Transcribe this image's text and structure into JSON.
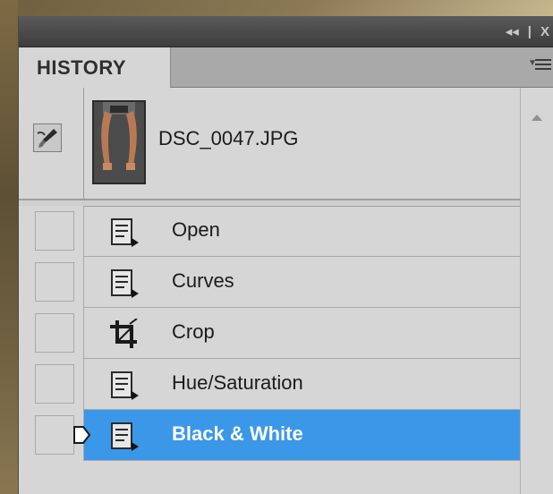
{
  "panel": {
    "title_controls": {
      "collapse": "◂◂",
      "separator": "|",
      "close": "X"
    },
    "tab": {
      "label": "HISTORY"
    },
    "menu": {
      "icon": "panel-menu-icon"
    }
  },
  "snapshot": {
    "name": "DSC_0047.JPG",
    "icon": "history-brush-icon"
  },
  "history": {
    "items": [
      {
        "label": "Open",
        "icon": "document-state-icon",
        "selected": false
      },
      {
        "label": "Curves",
        "icon": "document-state-icon",
        "selected": false
      },
      {
        "label": "Crop",
        "icon": "crop-tool-icon",
        "selected": false
      },
      {
        "label": "Hue/Saturation",
        "icon": "document-state-icon",
        "selected": false
      },
      {
        "label": "Black & White",
        "icon": "document-state-icon",
        "selected": true
      }
    ]
  },
  "colors": {
    "selection": "#3b97e8",
    "panel_bg": "#d6d6d6",
    "titlebar": "#3d3d3d"
  }
}
